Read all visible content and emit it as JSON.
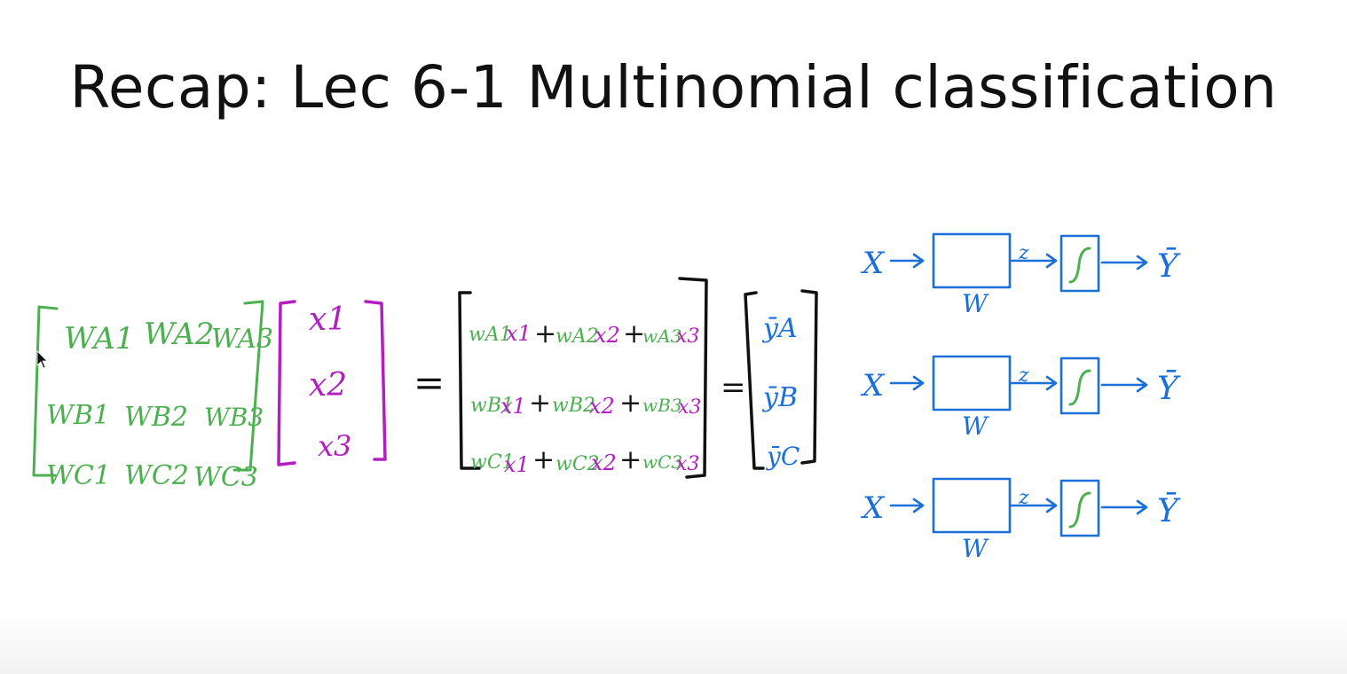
{
  "slide": {
    "title": "Recap: Lec 6-1 Multinomial classification"
  },
  "weight_matrix": {
    "rows": [
      [
        "WA1",
        "WA2",
        "WA3"
      ],
      [
        "WB1",
        "WB2",
        "WB3"
      ],
      [
        "WC1",
        "WC2",
        "WC3"
      ]
    ]
  },
  "input_vector": [
    "x1",
    "x2",
    "x3"
  ],
  "equals_sign": "=",
  "product_vector": {
    "rows": [
      [
        "wA1",
        "x1",
        "+",
        "wA2",
        "x2",
        "+",
        "wA3",
        "x3"
      ],
      [
        "wB1",
        "x1",
        "+",
        "wB2",
        "x2",
        "+",
        "wB3",
        "x3"
      ],
      [
        "wC1",
        "x1",
        "+",
        "wC2",
        "x2",
        "+",
        "wC3",
        "x3"
      ]
    ]
  },
  "output_vector": [
    "ȳA",
    "ȳB",
    "ȳC"
  ],
  "pipelines": [
    {
      "input": "X",
      "weight_label": "W",
      "z_label": "z",
      "output": "Ȳ"
    },
    {
      "input": "X",
      "weight_label": "W",
      "z_label": "z",
      "output": "Ȳ"
    },
    {
      "input": "X",
      "weight_label": "W",
      "z_label": "z",
      "output": "Ȳ"
    }
  ],
  "colors": {
    "weights": "#4caf50",
    "inputs": "#b21fc0",
    "outputs": "#1a6fd8",
    "ink": "#111111"
  }
}
